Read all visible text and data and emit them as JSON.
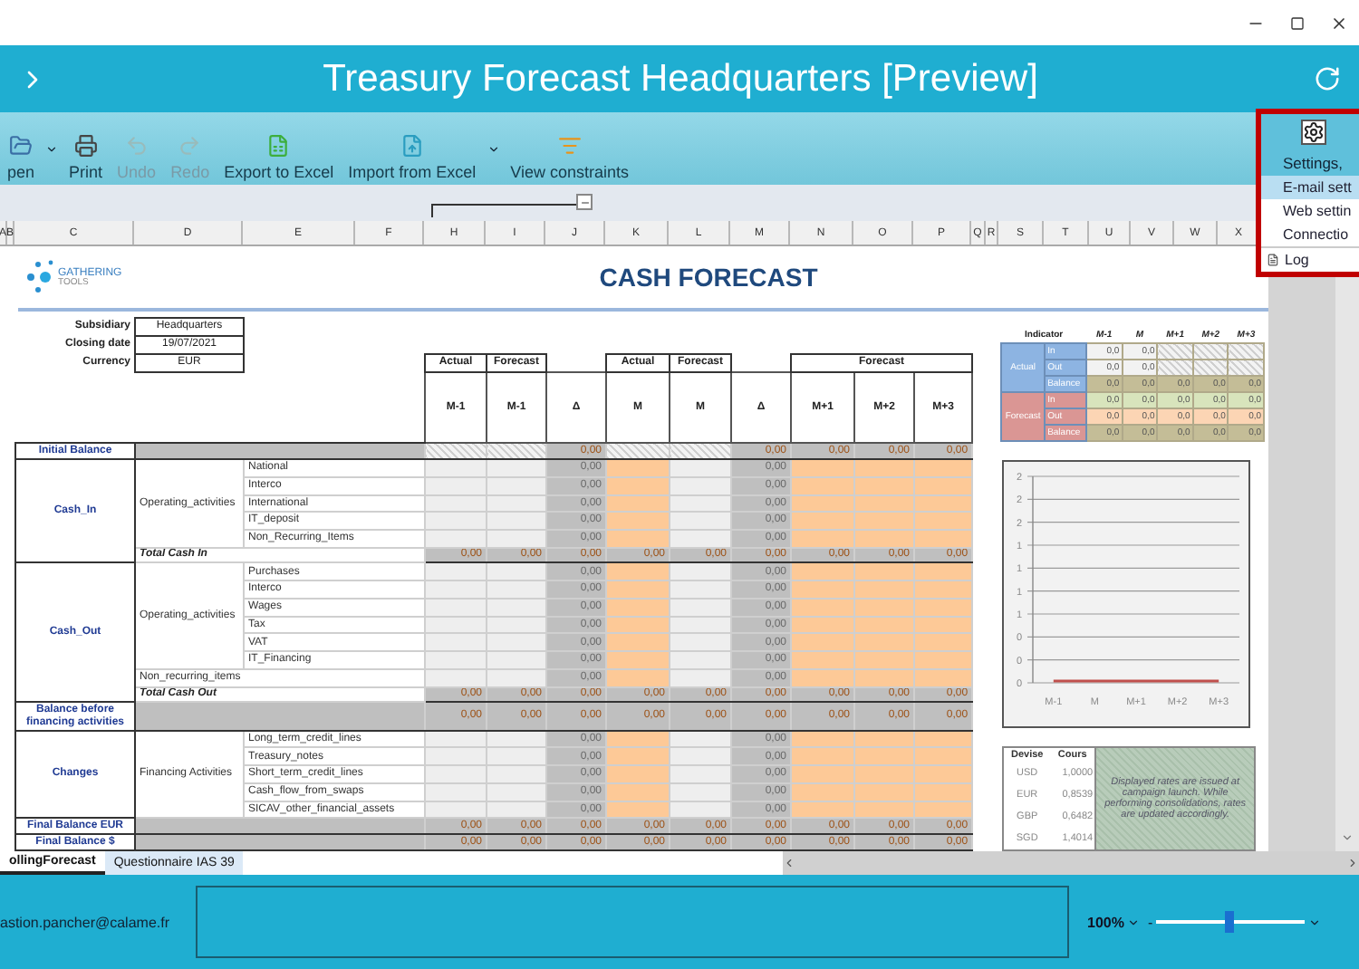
{
  "window": {
    "title": "Treasury Forecast Headquarters [Preview]"
  },
  "toolbar": {
    "items": [
      {
        "label": "pen",
        "disabled": false,
        "dropdown": true
      },
      {
        "label": "Print",
        "disabled": false,
        "dropdown": false
      },
      {
        "label": "Undo",
        "disabled": true,
        "dropdown": false
      },
      {
        "label": "Redo",
        "disabled": true,
        "dropdown": false
      },
      {
        "label": "Export to Excel",
        "disabled": false,
        "dropdown": false
      },
      {
        "label": "Import from Excel",
        "disabled": false,
        "dropdown": true
      },
      {
        "label": "View constraints",
        "disabled": false,
        "dropdown": false
      }
    ]
  },
  "settings_menu": {
    "button": "Settings,",
    "items": [
      {
        "label": "E-mail sett",
        "kind": "plain",
        "selected": true
      },
      {
        "label": "Web settin",
        "kind": "plain",
        "selected": false
      },
      {
        "label": "Connectio",
        "kind": "plain",
        "selected": false
      },
      {
        "label": "Log",
        "kind": "icon",
        "selected": false
      }
    ]
  },
  "column_headers": [
    "A",
    "B",
    "C",
    "D",
    "E",
    "F",
    "H",
    "I",
    "J",
    "K",
    "L",
    "M",
    "N",
    "O",
    "P",
    "Q",
    "R",
    "S",
    "T",
    "U",
    "V",
    "W",
    "X"
  ],
  "sheet": {
    "logo": {
      "name": "GATHERING",
      "sub": "TOOLS"
    },
    "title": "CASH FORECAST",
    "info": [
      {
        "label": "Subsidiary",
        "value": "Headquarters"
      },
      {
        "label": "Closing date",
        "value": "19/07/2021"
      },
      {
        "label": "Currency",
        "value": "EUR"
      }
    ],
    "column_groups": [
      {
        "label": "Actual",
        "periods": [
          "M-1"
        ]
      },
      {
        "label": "Forecast",
        "periods": [
          "M-1"
        ]
      },
      {
        "periods": [
          "Δ"
        ]
      },
      {
        "label": "Actual",
        "periods": [
          "M"
        ]
      },
      {
        "label": "Forecast",
        "periods": [
          "M"
        ]
      },
      {
        "periods": [
          "Δ"
        ]
      },
      {
        "label": "Forecast",
        "periods": [
          "M+1",
          "M+2",
          "M+3"
        ]
      }
    ],
    "sections": [
      {
        "kind": "balance",
        "label": "Initial Balance",
        "values": [
          {
            "kind": "blank"
          },
          {
            "kind": "blank"
          },
          {
            "kind": "value",
            "text": "0,00"
          },
          {
            "kind": "blank"
          },
          {
            "kind": "blank"
          },
          {
            "kind": "value",
            "text": "0,00"
          },
          {
            "kind": "value",
            "text": "0,00"
          },
          {
            "kind": "value",
            "text": "0,00"
          },
          {
            "kind": "value",
            "text": "0,00"
          }
        ]
      },
      {
        "kind": "flows",
        "label": "Cash_In",
        "groups": [
          {
            "label": "Operating_activities",
            "items": [
              {
                "label": "National",
                "values": [
                  {
                    "kind": "blank"
                  },
                  {
                    "kind": "blank"
                  },
                  {
                    "kind": "value",
                    "text": "0,00"
                  },
                  {
                    "kind": "blank"
                  },
                  {
                    "kind": "blank"
                  },
                  {
                    "kind": "value",
                    "text": "0,00"
                  },
                  {
                    "kind": "blank"
                  },
                  {
                    "kind": "blank"
                  },
                  {
                    "kind": "blank"
                  }
                ]
              },
              {
                "label": "Interco",
                "values": [
                  {
                    "kind": "blank"
                  },
                  {
                    "kind": "blank"
                  },
                  {
                    "kind": "value",
                    "text": "0,00"
                  },
                  {
                    "kind": "blank"
                  },
                  {
                    "kind": "blank"
                  },
                  {
                    "kind": "value",
                    "text": "0,00"
                  },
                  {
                    "kind": "blank"
                  },
                  {
                    "kind": "blank"
                  },
                  {
                    "kind": "blank"
                  }
                ]
              },
              {
                "label": "International",
                "values": [
                  {
                    "kind": "blank"
                  },
                  {
                    "kind": "blank"
                  },
                  {
                    "kind": "value",
                    "text": "0,00"
                  },
                  {
                    "kind": "blank"
                  },
                  {
                    "kind": "blank"
                  },
                  {
                    "kind": "value",
                    "text": "0,00"
                  },
                  {
                    "kind": "blank"
                  },
                  {
                    "kind": "blank"
                  },
                  {
                    "kind": "blank"
                  }
                ]
              },
              {
                "label": "IT_deposit",
                "values": [
                  {
                    "kind": "blank"
                  },
                  {
                    "kind": "blank"
                  },
                  {
                    "kind": "value",
                    "text": "0,00"
                  },
                  {
                    "kind": "blank"
                  },
                  {
                    "kind": "blank"
                  },
                  {
                    "kind": "value",
                    "text": "0,00"
                  },
                  {
                    "kind": "blank"
                  },
                  {
                    "kind": "blank"
                  },
                  {
                    "kind": "blank"
                  }
                ]
              },
              {
                "label": "Non_Recurring_Items",
                "values": [
                  {
                    "kind": "blank"
                  },
                  {
                    "kind": "blank"
                  },
                  {
                    "kind": "value",
                    "text": "0,00"
                  },
                  {
                    "kind": "blank"
                  },
                  {
                    "kind": "blank"
                  },
                  {
                    "kind": "value",
                    "text": "0,00"
                  },
                  {
                    "kind": "blank"
                  },
                  {
                    "kind": "blank"
                  },
                  {
                    "kind": "blank"
                  }
                ]
              }
            ]
          }
        ],
        "total": {
          "label": "Total Cash In",
          "values": [
            {
              "kind": "value",
              "text": "0,00"
            },
            {
              "kind": "value",
              "text": "0,00"
            },
            {
              "kind": "value",
              "text": "0,00"
            },
            {
              "kind": "value",
              "text": "0,00"
            },
            {
              "kind": "value",
              "text": "0,00"
            },
            {
              "kind": "value",
              "text": "0,00"
            },
            {
              "kind": "value",
              "text": "0,00"
            },
            {
              "kind": "value",
              "text": "0,00"
            },
            {
              "kind": "value",
              "text": "0,00"
            }
          ]
        }
      },
      {
        "kind": "flows",
        "label": "Cash_Out",
        "groups": [
          {
            "label": "Operating_activities",
            "items": [
              {
                "label": "Purchases",
                "values": [
                  {
                    "kind": "blank"
                  },
                  {
                    "kind": "blank"
                  },
                  {
                    "kind": "value",
                    "text": "0,00"
                  },
                  {
                    "kind": "blank"
                  },
                  {
                    "kind": "blank"
                  },
                  {
                    "kind": "value",
                    "text": "0,00"
                  },
                  {
                    "kind": "blank"
                  },
                  {
                    "kind": "blank"
                  },
                  {
                    "kind": "blank"
                  }
                ]
              },
              {
                "label": "Interco",
                "values": [
                  {
                    "kind": "blank"
                  },
                  {
                    "kind": "blank"
                  },
                  {
                    "kind": "value",
                    "text": "0,00"
                  },
                  {
                    "kind": "blank"
                  },
                  {
                    "kind": "blank"
                  },
                  {
                    "kind": "value",
                    "text": "0,00"
                  },
                  {
                    "kind": "blank"
                  },
                  {
                    "kind": "blank"
                  },
                  {
                    "kind": "blank"
                  }
                ]
              },
              {
                "label": "Wages",
                "values": [
                  {
                    "kind": "blank"
                  },
                  {
                    "kind": "blank"
                  },
                  {
                    "kind": "value",
                    "text": "0,00"
                  },
                  {
                    "kind": "blank"
                  },
                  {
                    "kind": "blank"
                  },
                  {
                    "kind": "value",
                    "text": "0,00"
                  },
                  {
                    "kind": "blank"
                  },
                  {
                    "kind": "blank"
                  },
                  {
                    "kind": "blank"
                  }
                ]
              },
              {
                "label": "Tax",
                "values": [
                  {
                    "kind": "blank"
                  },
                  {
                    "kind": "blank"
                  },
                  {
                    "kind": "value",
                    "text": "0,00"
                  },
                  {
                    "kind": "blank"
                  },
                  {
                    "kind": "blank"
                  },
                  {
                    "kind": "value",
                    "text": "0,00"
                  },
                  {
                    "kind": "blank"
                  },
                  {
                    "kind": "blank"
                  },
                  {
                    "kind": "blank"
                  }
                ]
              },
              {
                "label": "VAT",
                "values": [
                  {
                    "kind": "blank"
                  },
                  {
                    "kind": "blank"
                  },
                  {
                    "kind": "value",
                    "text": "0,00"
                  },
                  {
                    "kind": "blank"
                  },
                  {
                    "kind": "blank"
                  },
                  {
                    "kind": "value",
                    "text": "0,00"
                  },
                  {
                    "kind": "blank"
                  },
                  {
                    "kind": "blank"
                  },
                  {
                    "kind": "blank"
                  }
                ]
              },
              {
                "label": "IT_Financing",
                "values": [
                  {
                    "kind": "blank"
                  },
                  {
                    "kind": "blank"
                  },
                  {
                    "kind": "value",
                    "text": "0,00"
                  },
                  {
                    "kind": "blank"
                  },
                  {
                    "kind": "blank"
                  },
                  {
                    "kind": "value",
                    "text": "0,00"
                  },
                  {
                    "kind": "blank"
                  },
                  {
                    "kind": "blank"
                  },
                  {
                    "kind": "blank"
                  }
                ]
              }
            ]
          },
          {
            "label": "Non_recurring_items",
            "items": [
              {
                "values": [
                  {
                    "kind": "blank"
                  },
                  {
                    "kind": "blank"
                  },
                  {
                    "kind": "value",
                    "text": "0,00"
                  },
                  {
                    "kind": "blank"
                  },
                  {
                    "kind": "blank"
                  },
                  {
                    "kind": "value",
                    "text": "0,00"
                  },
                  {
                    "kind": "blank"
                  },
                  {
                    "kind": "blank"
                  },
                  {
                    "kind": "blank"
                  }
                ]
              }
            ]
          }
        ],
        "total": {
          "label": "Total Cash Out",
          "values": [
            {
              "kind": "value",
              "text": "0,00"
            },
            {
              "kind": "value",
              "text": "0,00"
            },
            {
              "kind": "value",
              "text": "0,00"
            },
            {
              "kind": "value",
              "text": "0,00"
            },
            {
              "kind": "value",
              "text": "0,00"
            },
            {
              "kind": "value",
              "text": "0,00"
            },
            {
              "kind": "value",
              "text": "0,00"
            },
            {
              "kind": "value",
              "text": "0,00"
            },
            {
              "kind": "value",
              "text": "0,00"
            }
          ]
        }
      },
      {
        "kind": "balance",
        "label": "Balance before financing activities",
        "values": [
          {
            "kind": "value",
            "text": "0,00"
          },
          {
            "kind": "value",
            "text": "0,00"
          },
          {
            "kind": "value",
            "text": "0,00"
          },
          {
            "kind": "value",
            "text": "0,00"
          },
          {
            "kind": "value",
            "text": "0,00"
          },
          {
            "kind": "value",
            "text": "0,00"
          },
          {
            "kind": "value",
            "text": "0,00"
          },
          {
            "kind": "value",
            "text": "0,00"
          },
          {
            "kind": "value",
            "text": "0,00"
          }
        ]
      },
      {
        "kind": "flows",
        "label": "Changes",
        "groups": [
          {
            "label": "Financing Activities",
            "items": [
              {
                "label": "Long_term_credit_lines",
                "values": [
                  {
                    "kind": "blank"
                  },
                  {
                    "kind": "blank"
                  },
                  {
                    "kind": "value",
                    "text": "0,00"
                  },
                  {
                    "kind": "blank"
                  },
                  {
                    "kind": "blank"
                  },
                  {
                    "kind": "value",
                    "text": "0,00"
                  },
                  {
                    "kind": "blank"
                  },
                  {
                    "kind": "blank"
                  },
                  {
                    "kind": "blank"
                  }
                ]
              },
              {
                "label": "Treasury_notes",
                "values": [
                  {
                    "kind": "blank"
                  },
                  {
                    "kind": "blank"
                  },
                  {
                    "kind": "value",
                    "text": "0,00"
                  },
                  {
                    "kind": "blank"
                  },
                  {
                    "kind": "blank"
                  },
                  {
                    "kind": "value",
                    "text": "0,00"
                  },
                  {
                    "kind": "blank"
                  },
                  {
                    "kind": "blank"
                  },
                  {
                    "kind": "blank"
                  }
                ]
              },
              {
                "label": "Short_term_credit_lines",
                "values": [
                  {
                    "kind": "blank"
                  },
                  {
                    "kind": "blank"
                  },
                  {
                    "kind": "value",
                    "text": "0,00"
                  },
                  {
                    "kind": "blank"
                  },
                  {
                    "kind": "blank"
                  },
                  {
                    "kind": "value",
                    "text": "0,00"
                  },
                  {
                    "kind": "blank"
                  },
                  {
                    "kind": "blank"
                  },
                  {
                    "kind": "blank"
                  }
                ]
              },
              {
                "label": "Cash_flow_from_swaps",
                "values": [
                  {
                    "kind": "blank"
                  },
                  {
                    "kind": "blank"
                  },
                  {
                    "kind": "value",
                    "text": "0,00"
                  },
                  {
                    "kind": "blank"
                  },
                  {
                    "kind": "blank"
                  },
                  {
                    "kind": "value",
                    "text": "0,00"
                  },
                  {
                    "kind": "blank"
                  },
                  {
                    "kind": "blank"
                  },
                  {
                    "kind": "blank"
                  }
                ]
              },
              {
                "label": "SICAV_other_financial_assets",
                "values": [
                  {
                    "kind": "blank"
                  },
                  {
                    "kind": "blank"
                  },
                  {
                    "kind": "value",
                    "text": "0,00"
                  },
                  {
                    "kind": "blank"
                  },
                  {
                    "kind": "blank"
                  },
                  {
                    "kind": "value",
                    "text": "0,00"
                  },
                  {
                    "kind": "blank"
                  },
                  {
                    "kind": "blank"
                  },
                  {
                    "kind": "blank"
                  }
                ]
              }
            ]
          }
        ]
      },
      {
        "kind": "balance",
        "label": "Final Balance EUR",
        "values": [
          {
            "kind": "value",
            "text": "0,00"
          },
          {
            "kind": "value",
            "text": "0,00"
          },
          {
            "kind": "value",
            "text": "0,00"
          },
          {
            "kind": "value",
            "text": "0,00"
          },
          {
            "kind": "value",
            "text": "0,00"
          },
          {
            "kind": "value",
            "text": "0,00"
          },
          {
            "kind": "value",
            "text": "0,00"
          },
          {
            "kind": "value",
            "text": "0,00"
          },
          {
            "kind": "value",
            "text": "0,00"
          }
        ]
      },
      {
        "kind": "balance",
        "label": "Final Balance $",
        "values": [
          {
            "kind": "value",
            "text": "0,00"
          },
          {
            "kind": "value",
            "text": "0,00"
          },
          {
            "kind": "value",
            "text": "0,00"
          },
          {
            "kind": "value",
            "text": "0,00"
          },
          {
            "kind": "value",
            "text": "0,00"
          },
          {
            "kind": "value",
            "text": "0,00"
          },
          {
            "kind": "value",
            "text": "0,00"
          },
          {
            "kind": "value",
            "text": "0,00"
          },
          {
            "kind": "value",
            "text": "0,00"
          }
        ]
      }
    ]
  },
  "indicator": {
    "heading": "Indicator",
    "columns": [
      "M-1",
      "M",
      "M+1",
      "M+2",
      "M+3"
    ],
    "groups": [
      {
        "label": "Actual",
        "color": "#8db4e2",
        "rows": [
          {
            "label": "In",
            "kind": "in",
            "values": [
              {
                "kind": "value",
                "text": "0,0"
              },
              {
                "kind": "value",
                "text": "0,0"
              },
              {
                "kind": "blank"
              },
              {
                "kind": "blank"
              },
              {
                "kind": "blank"
              }
            ]
          },
          {
            "label": "Out",
            "kind": "out",
            "values": [
              {
                "kind": "value",
                "text": "0,0"
              },
              {
                "kind": "value",
                "text": "0,0"
              },
              {
                "kind": "blank"
              },
              {
                "kind": "blank"
              },
              {
                "kind": "blank"
              }
            ]
          },
          {
            "label": "Balance",
            "kind": "balance",
            "values": [
              {
                "kind": "value",
                "text": "0,0"
              },
              {
                "kind": "value",
                "text": "0,0"
              },
              {
                "kind": "value",
                "text": "0,0"
              },
              {
                "kind": "value",
                "text": "0,0"
              },
              {
                "kind": "value",
                "text": "0,0"
              }
            ]
          }
        ]
      },
      {
        "label": "Forecast",
        "color": "#da9694",
        "rows": [
          {
            "label": "In",
            "kind": "in",
            "values": [
              {
                "kind": "value",
                "text": "0,0"
              },
              {
                "kind": "value",
                "text": "0,0"
              },
              {
                "kind": "value",
                "text": "0,0"
              },
              {
                "kind": "value",
                "text": "0,0"
              },
              {
                "kind": "value",
                "text": "0,0"
              }
            ]
          },
          {
            "label": "Out",
            "kind": "out",
            "values": [
              {
                "kind": "value",
                "text": "0,0"
              },
              {
                "kind": "value",
                "text": "0,0"
              },
              {
                "kind": "value",
                "text": "0,0"
              },
              {
                "kind": "value",
                "text": "0,0"
              },
              {
                "kind": "value",
                "text": "0,0"
              }
            ]
          },
          {
            "label": "Balance",
            "kind": "balance",
            "values": [
              {
                "kind": "value",
                "text": "0,0"
              },
              {
                "kind": "value",
                "text": "0,0"
              },
              {
                "kind": "value",
                "text": "0,0"
              },
              {
                "kind": "value",
                "text": "0,0"
              },
              {
                "kind": "value",
                "text": "0,0"
              }
            ]
          }
        ]
      }
    ]
  },
  "chart": {
    "chart_data": {
      "type": "line",
      "categories": [
        "M-1",
        "M",
        "M+1",
        "M+2",
        "M+3"
      ],
      "series": [
        {
          "color": "#c0504d",
          "values": [
            0,
            0,
            0,
            0,
            0
          ]
        }
      ],
      "ylim": [
        0,
        2.25
      ],
      "grid": true,
      "yticks": [
        {
          "value": 0,
          "label": "0"
        },
        {
          "value": 0.25,
          "label": "0"
        },
        {
          "value": 0.5,
          "label": "0"
        },
        {
          "value": 0.75,
          "label": "1"
        },
        {
          "value": 1,
          "label": "1"
        },
        {
          "value": 1.25,
          "label": "1"
        },
        {
          "value": 1.5,
          "label": "1"
        },
        {
          "value": 1.75,
          "label": "2"
        },
        {
          "value": 2,
          "label": "2"
        },
        {
          "value": 2.25,
          "label": "2"
        }
      ]
    }
  },
  "rates": {
    "columns": [
      "Devise",
      "Cours"
    ],
    "rows": [
      [
        "USD",
        "1,0000"
      ],
      [
        "EUR",
        "0,8539"
      ],
      [
        "GBP",
        "0,6482"
      ],
      [
        "SGD",
        "1,4014"
      ]
    ],
    "note": "Displayed rates are issued at campaign launch. While performing consolidations, rates are updated accordingly."
  },
  "sheet_tabs": [
    {
      "label": "ollingForecast",
      "selected": true
    },
    {
      "label": "Questionnaire IAS 39",
      "selected": false
    }
  ],
  "status_bar": {
    "user": "astion.pancher@calame.fr",
    "zoom": "100%",
    "zoom_out": "-",
    "zoom_slider": {
      "level": 0.49
    }
  }
}
